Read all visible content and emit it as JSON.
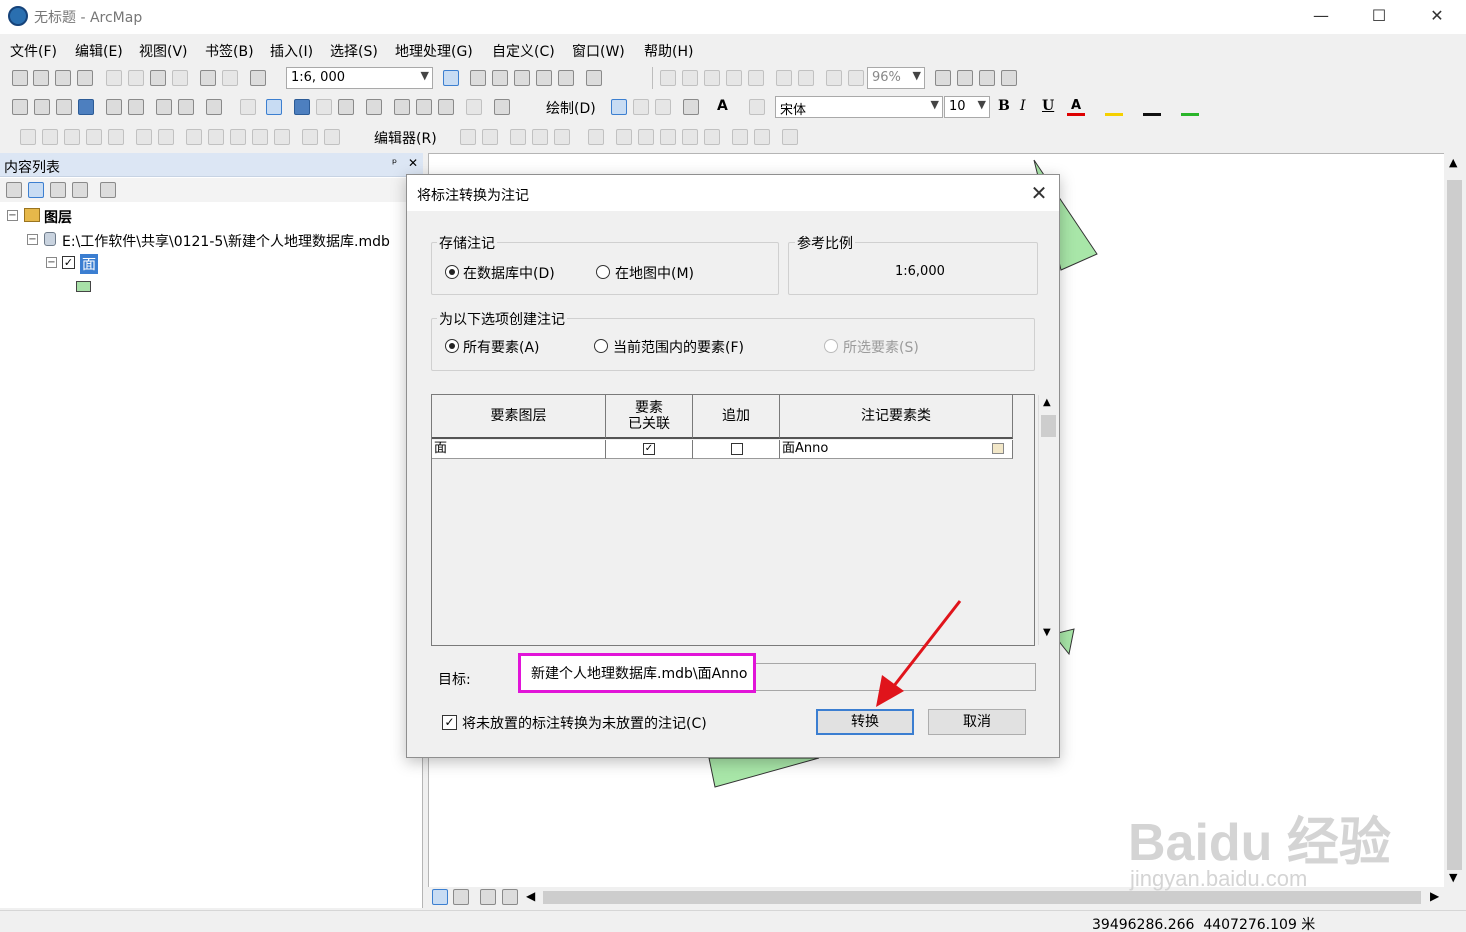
{
  "window": {
    "title": "无标题 - ArcMap",
    "min": "—",
    "max": "☐",
    "close": "✕"
  },
  "menu": [
    "文件(F)",
    "编辑(E)",
    "视图(V)",
    "书签(B)",
    "插入(I)",
    "选择(S)",
    "地理处理(G)",
    "自定义(C)",
    "窗口(W)",
    "帮助(H)"
  ],
  "toolbar": {
    "scale": "1:6, 000",
    "zoom": "96%",
    "draw_label": "绘制(D)",
    "font_name": "宋体",
    "font_size": "10",
    "bold": "B",
    "italic": "I",
    "underline": "U",
    "editor_label": "编辑器(R)"
  },
  "toc": {
    "title": "内容列表",
    "pin": "ᵖ",
    "close": "✕",
    "root_label": "图层",
    "db_label": "E:\\工作软件\\共享\\0121-5\\新建个人地理数据库.mdb",
    "layer_label": "面",
    "symbol_color": "#a8e0a8"
  },
  "dialog": {
    "title": "将标注转换为注记",
    "store_group": "存储注记",
    "store_db": "在数据库中(D)",
    "store_map": "在地图中(M)",
    "ref_scale_group": "参考比例",
    "ref_scale_value": "1:6,000",
    "create_group": "为以下选项创建注记",
    "create_all": "所有要素(A)",
    "create_extent": "当前范围内的要素(F)",
    "create_selected": "所选要素(S)",
    "columns": {
      "layer": "要素图层",
      "linked_1": "要素",
      "linked_2": "已关联",
      "append": "追加",
      "anno_class": "注记要素类"
    },
    "rows": [
      {
        "layer": "面",
        "linked": true,
        "append": false,
        "anno_class": "面Anno"
      }
    ],
    "target_label": "目标:",
    "target_value": "新建个人地理数据库.mdb\\面Anno",
    "unplaced_label": "将未放置的标注转换为未放置的注记(C)",
    "unplaced_checked": true,
    "convert_button": "转换",
    "cancel_button": "取消"
  },
  "status": {
    "coords": "39496286.266  4407276.109 米"
  },
  "watermark": {
    "brand": "Baidu 经验",
    "url": "jingyan.baidu.com"
  },
  "colors": {
    "polygon_fill": "#a8e6a8",
    "highlight": "#e114d8",
    "arrow": "#e0141b"
  }
}
